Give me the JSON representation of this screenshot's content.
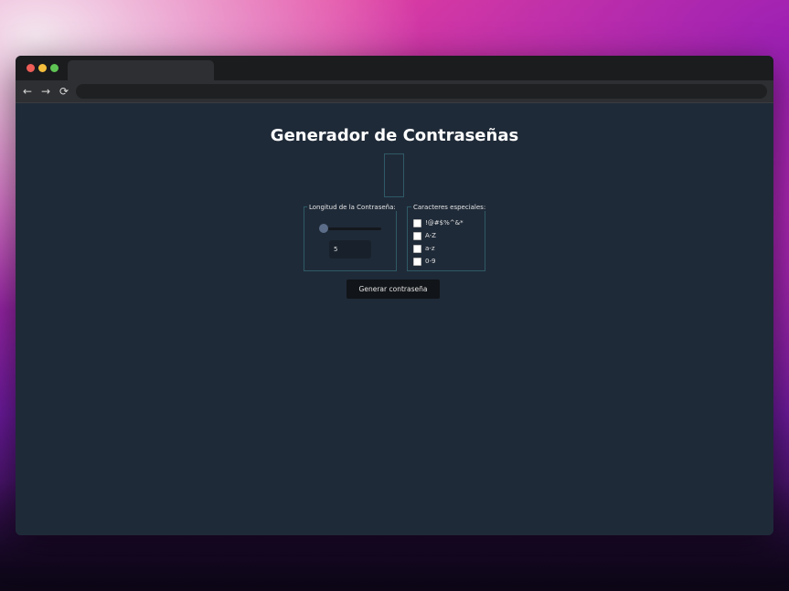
{
  "page": {
    "title": "Generador de Contraseñas",
    "length_legend": "Longitud de la Contraseña:",
    "length_value": "5",
    "slider_level": 0.0,
    "chars_legend": "Caracteres especiales:",
    "options": [
      {
        "label": "!@#$%^&*",
        "checked": false
      },
      {
        "label": "A-Z",
        "checked": false
      },
      {
        "label": "a-z",
        "checked": false
      },
      {
        "label": "0-9",
        "checked": false
      }
    ],
    "generate_label": "Generar contraseña"
  },
  "browser": {
    "back_icon": "←",
    "forward_icon": "→",
    "reload_icon": "⟳"
  },
  "colors": {
    "page_bg": "#1f2a38",
    "border": "#2f5a66",
    "button_bg": "#111418"
  }
}
